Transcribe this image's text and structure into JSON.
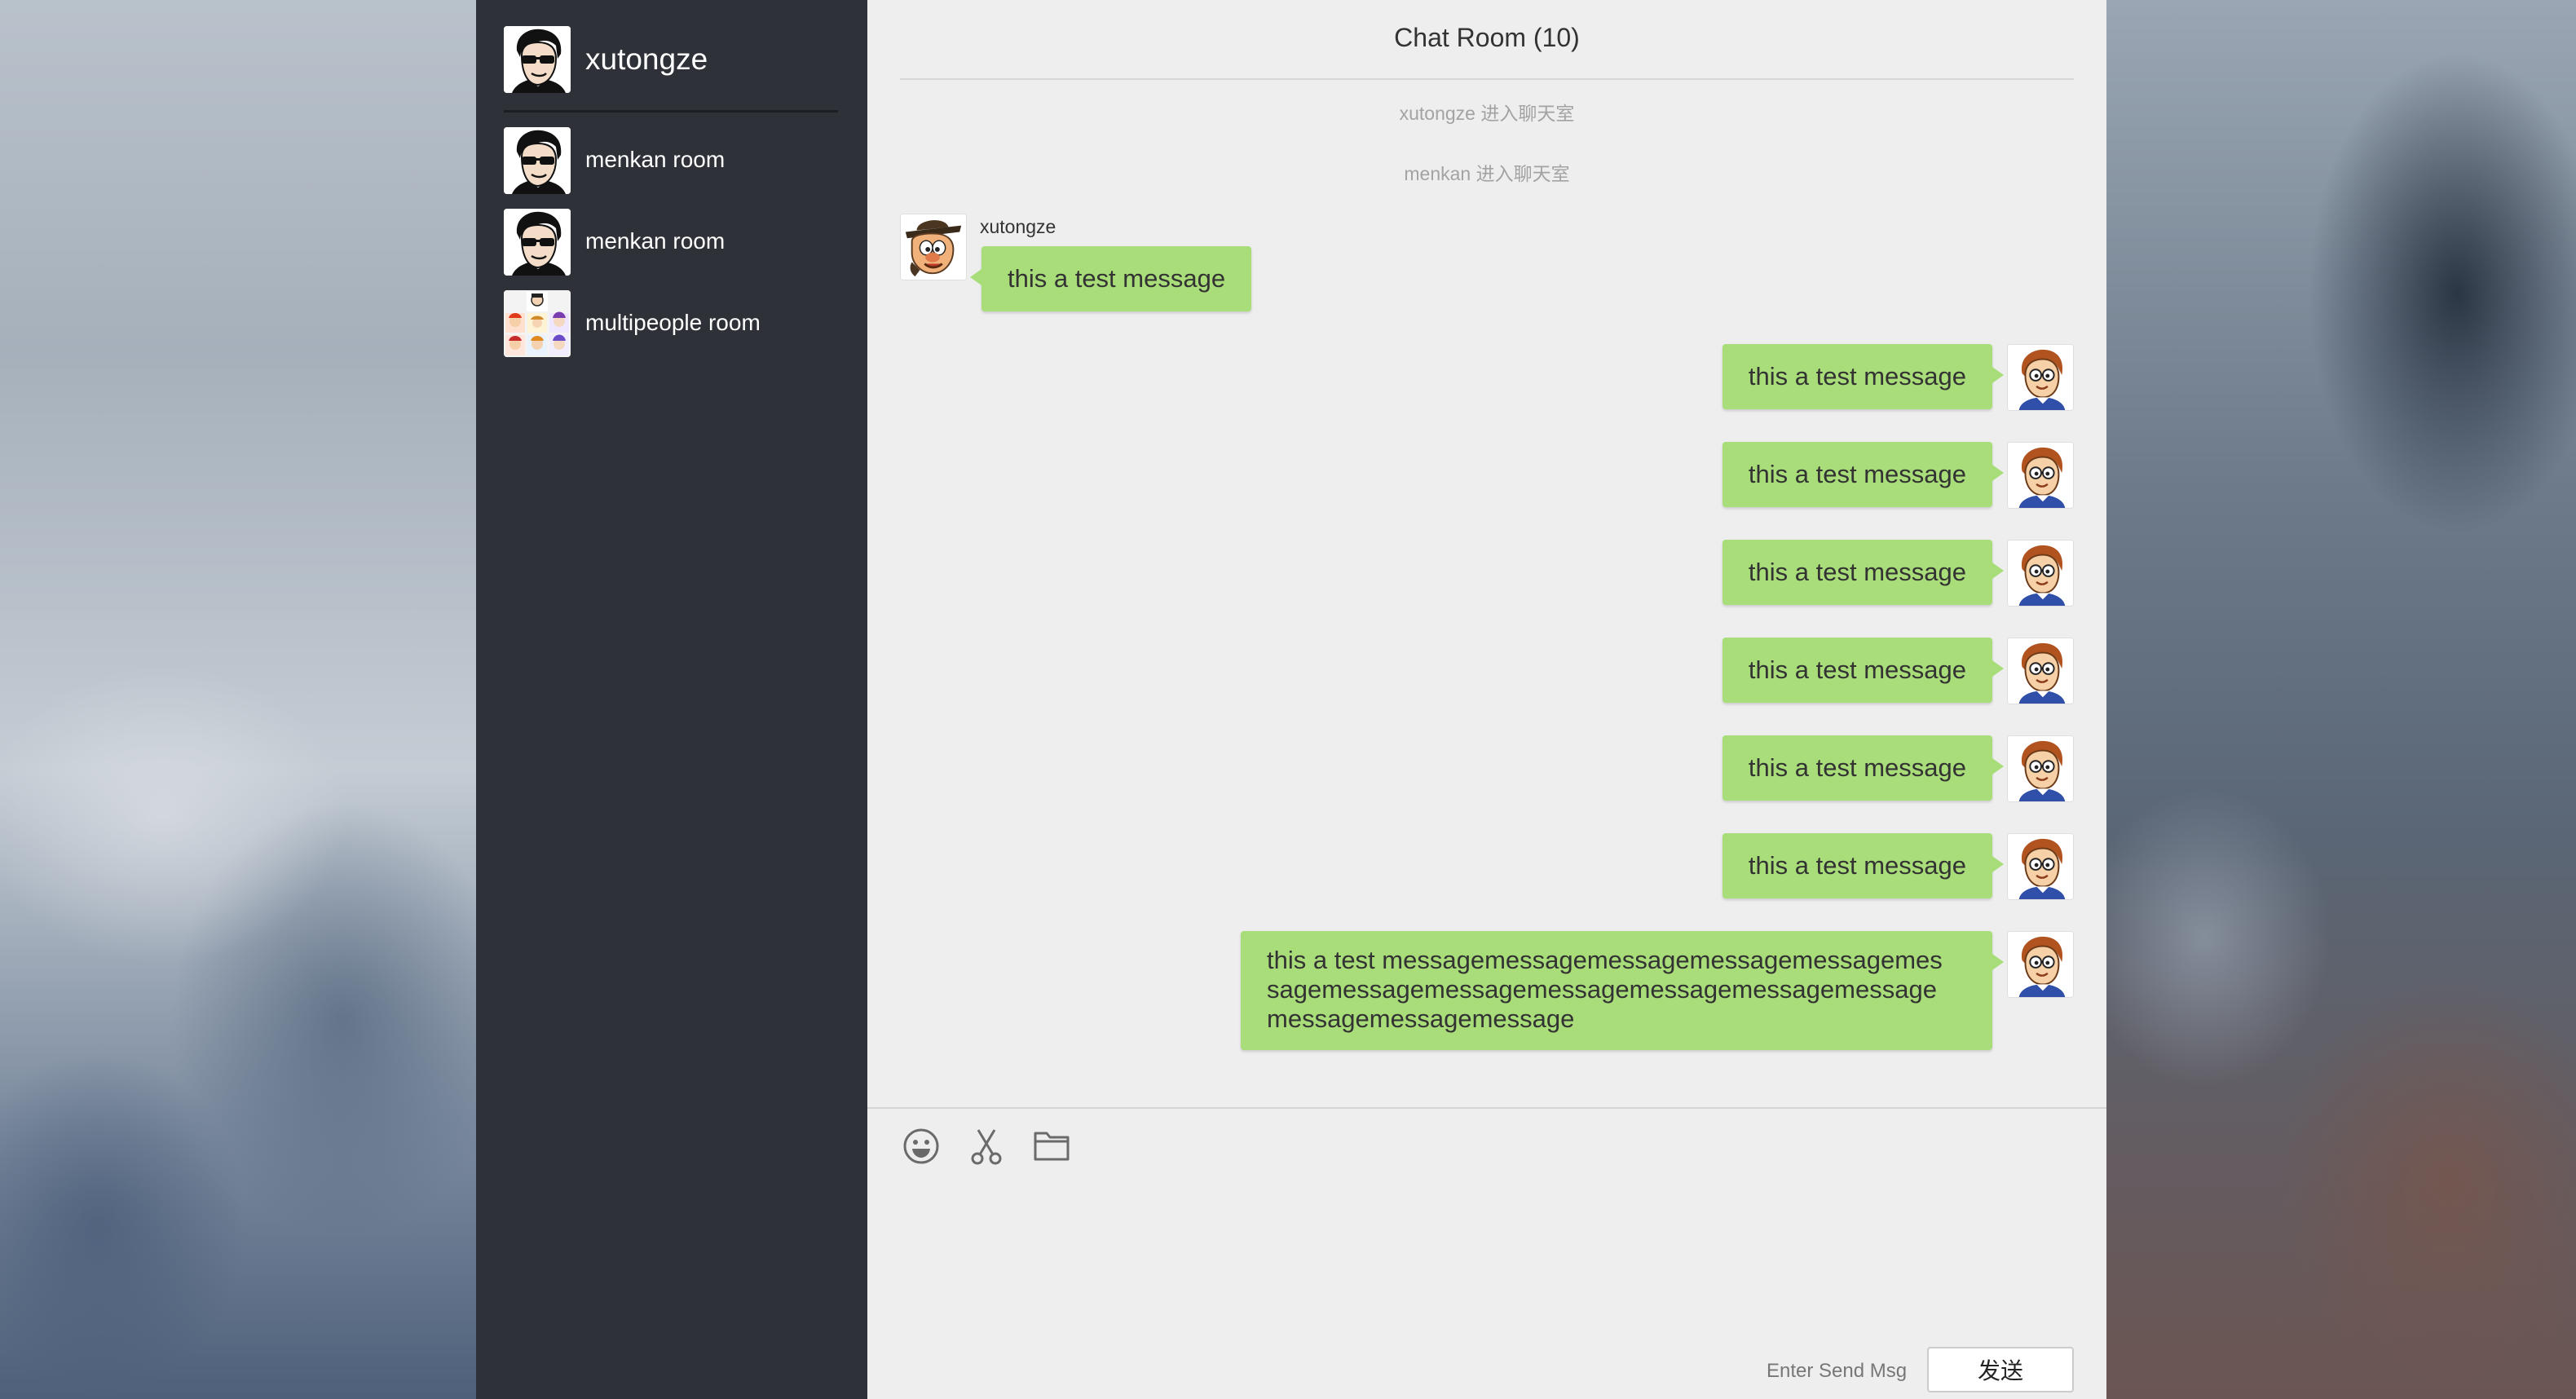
{
  "user": {
    "name": "xutongze",
    "avatar_icon": "sunglasses-man-avatar-icon"
  },
  "rooms": [
    {
      "name": "menkan room",
      "avatar_icon": "sunglasses-man-avatar-icon"
    },
    {
      "name": "menkan room",
      "avatar_icon": "sunglasses-man-avatar-icon"
    },
    {
      "name": "multipeople room",
      "avatar_icon": "group-collage-avatar-icon"
    }
  ],
  "chat": {
    "title": "Chat Room (10)",
    "system_messages": [
      "xutongze 进入聊天室",
      "menkan 进入聊天室"
    ],
    "incoming": {
      "sender": "xutongze",
      "text": "this a test message",
      "avatar_icon": "cartoon-hat-man-avatar-icon"
    },
    "outgoing": [
      "this a test message",
      "this a test message",
      "this a test message",
      "this a test message",
      "this a test message",
      "this a test message"
    ],
    "outgoing_long": [
      "this a test messagemessagemessagemessagemessagemes",
      "sagemessagemessagemessagemessagemessagemessage",
      "messagemessagemessage"
    ],
    "self_avatar_icon": "cartoon-glasses-boy-avatar-icon"
  },
  "composer": {
    "tools": [
      "emoji-icon",
      "scissors-icon",
      "folder-icon"
    ],
    "input_value": "",
    "hint": "Enter Send Msg",
    "send_label": "发送"
  },
  "colors": {
    "sidebar_bg": "#2e3238",
    "chat_bg": "#eeeeee",
    "bubble_green": "#a8dd79",
    "system_text": "#a3a3a3"
  }
}
